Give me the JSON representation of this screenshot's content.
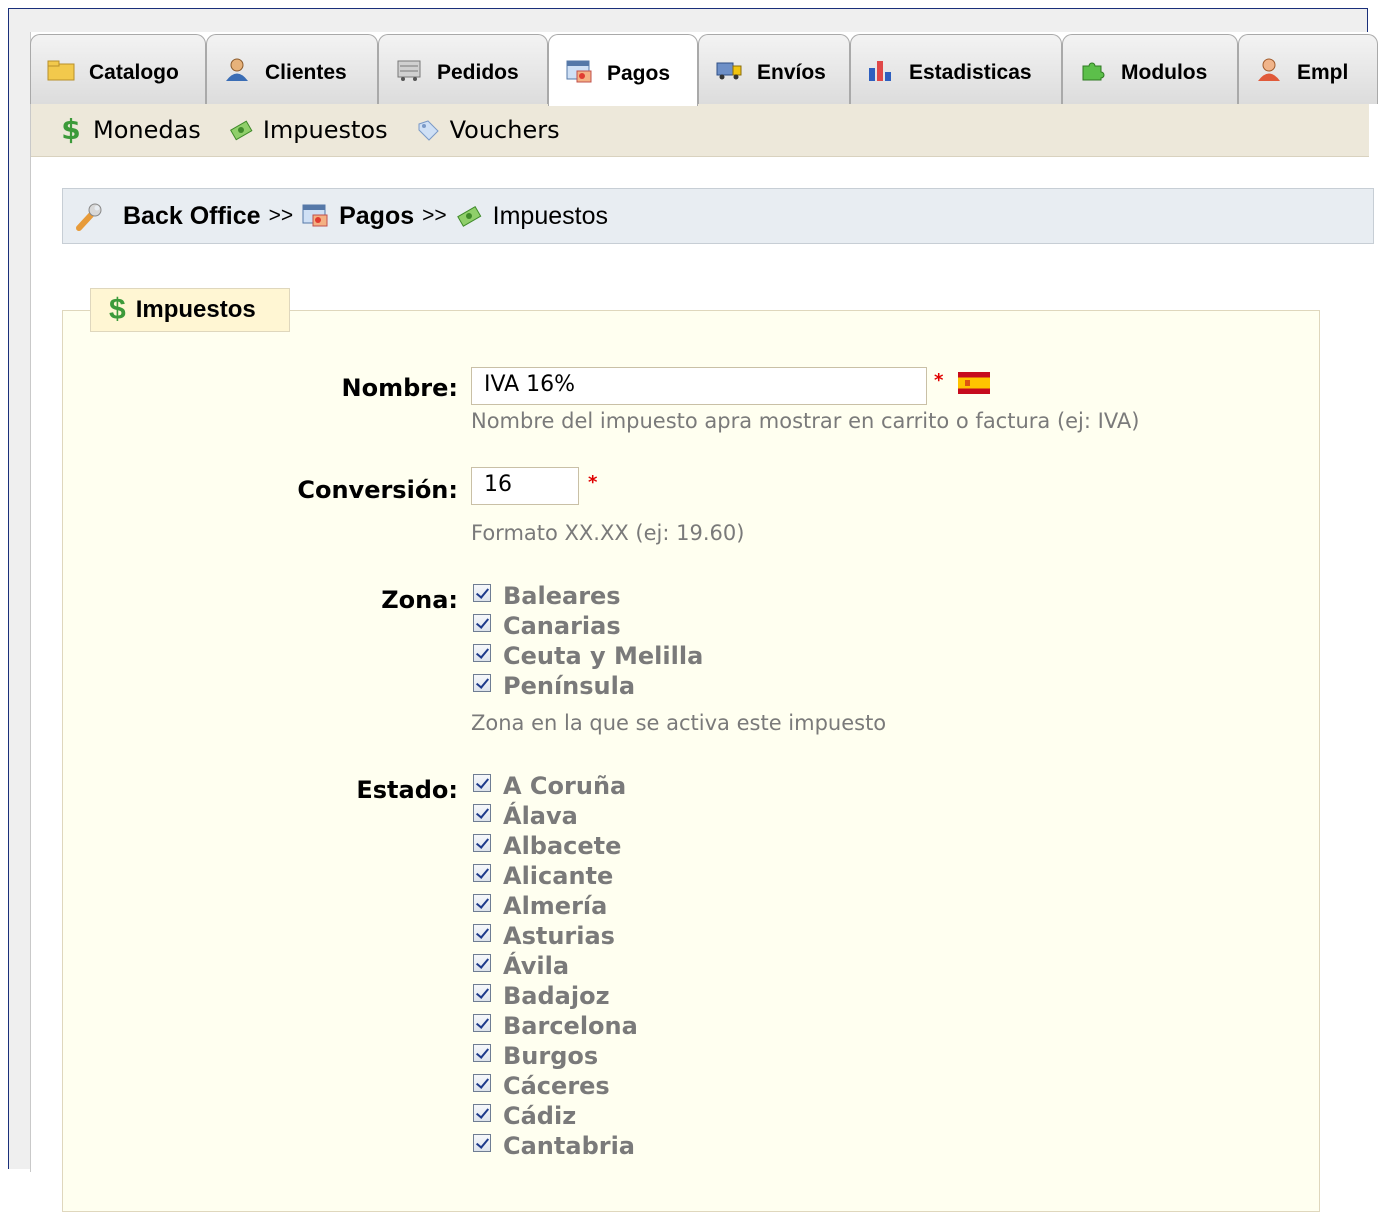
{
  "tabs": [
    {
      "label": "Catalogo",
      "icon": "folder-icon"
    },
    {
      "label": "Clientes",
      "icon": "user-icon"
    },
    {
      "label": "Pedidos",
      "icon": "cart-icon"
    },
    {
      "label": "Pagos",
      "icon": "payment-card-icon",
      "active": true
    },
    {
      "label": "Envíos",
      "icon": "truck-icon"
    },
    {
      "label": "Estadisticas",
      "icon": "bar-chart-icon"
    },
    {
      "label": "Modulos",
      "icon": "puzzle-icon"
    },
    {
      "label": "Empl",
      "icon": "employee-icon"
    }
  ],
  "subnav": [
    {
      "label": "Monedas",
      "icon": "dollar-icon"
    },
    {
      "label": "Impuestos",
      "icon": "money-icon"
    },
    {
      "label": "Vouchers",
      "icon": "voucher-tag-icon"
    }
  ],
  "breadcrumb": {
    "root": "Back Office",
    "sep1": ">>",
    "section": "Pagos",
    "sep2": ">>",
    "page": "Impuestos"
  },
  "form": {
    "legend": "Impuestos",
    "nombre": {
      "label": "Nombre:",
      "value": "IVA 16%",
      "required": "*",
      "hint": "Nombre del impuesto apra mostrar en carrito o factura (ej: IVA)"
    },
    "conversion": {
      "label": "Conversión:",
      "value": "16",
      "required": "*",
      "hint": "Formato XX.XX (ej: 19.60)"
    },
    "zona": {
      "label": "Zona:",
      "options": [
        "Baleares",
        "Canarias",
        "Ceuta y Melilla",
        "Península"
      ],
      "hint": "Zona en la que se activa este impuesto"
    },
    "estado": {
      "label": "Estado:",
      "options": [
        "A Coruña",
        "Álava",
        "Albacete",
        "Alicante",
        "Almería",
        "Asturias",
        "Ávila",
        "Badajoz",
        "Barcelona",
        "Burgos",
        "Cáceres",
        "Cádiz",
        "Cantabria"
      ]
    }
  },
  "colors": {
    "required": "#e00000",
    "panel_bg": "#fffff0",
    "subnav_bg": "#ede8da",
    "breadcrumb_bg": "#e8edf2"
  }
}
